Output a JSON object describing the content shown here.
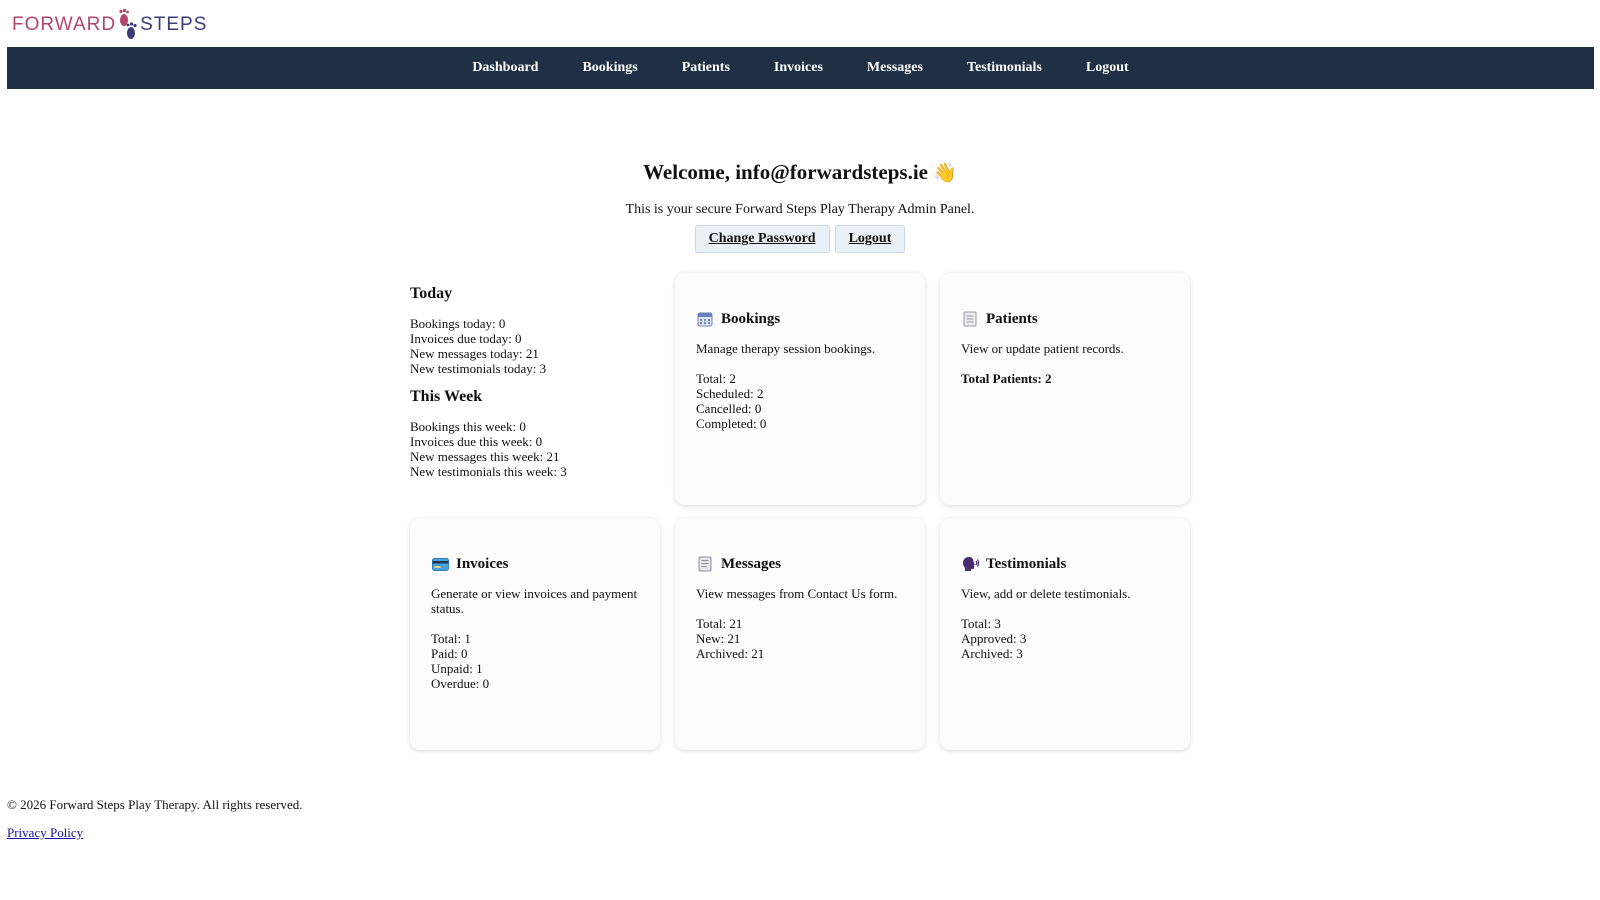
{
  "brand": {
    "word1": "FORWARD",
    "word2": "STEPS"
  },
  "nav": [
    "Dashboard",
    "Bookings",
    "Patients",
    "Invoices",
    "Messages",
    "Testimonials",
    "Logout"
  ],
  "welcome": {
    "text": "Welcome, info@forwardsteps.ie",
    "emoji": "👋"
  },
  "subtitle": "This is your secure Forward Steps Play Therapy Admin Panel.",
  "actions": {
    "change_password": "Change Password",
    "logout": "Logout"
  },
  "summary": {
    "today_title": "Today",
    "today": [
      "Bookings today: 0",
      "Invoices due today: 0",
      "New messages today: 21",
      "New testimonials today: 3"
    ],
    "week_title": "This Week",
    "week": [
      "Bookings this week: 0",
      "Invoices due this week: 0",
      "New messages this week: 21",
      "New testimonials this week: 3"
    ]
  },
  "cards": {
    "bookings": {
      "title": "Bookings",
      "icon": "calendar-icon",
      "desc": "Manage therapy session bookings.",
      "stats": [
        "Total: 2",
        "Scheduled: 2",
        "Cancelled: 0",
        "Completed: 0"
      ]
    },
    "patients": {
      "title": "Patients",
      "icon": "document-icon",
      "desc": "View or update patient records.",
      "total": "Total Patients: 2"
    },
    "invoices": {
      "title": "Invoices",
      "icon": "credit-card-icon",
      "desc": "Generate or view invoices and payment status.",
      "stats": [
        "Total: 1",
        "Paid: 0",
        "Unpaid: 1",
        "Overdue: 0"
      ]
    },
    "messages": {
      "title": "Messages",
      "icon": "scroll-icon",
      "desc": "View messages from Contact Us form.",
      "stats": [
        "Total: 21",
        "New: 21",
        "Archived: 21"
      ]
    },
    "testimonials": {
      "title": "Testimonials",
      "icon": "speaking-head-icon",
      "desc": "View, add or delete testimonials.",
      "stats": [
        "Total: 3",
        "Approved: 3",
        "Archived: 3"
      ]
    }
  },
  "footer": {
    "copyright": "© 2026 Forward Steps Play Therapy. All rights reserved.",
    "privacy": "Privacy Policy"
  },
  "colors": {
    "navbar": "#1f2f44",
    "brand_pink": "#b0466e",
    "brand_navy": "#3c3c7a",
    "button_bg": "#e9f0f8",
    "link": "#1a0dab"
  }
}
